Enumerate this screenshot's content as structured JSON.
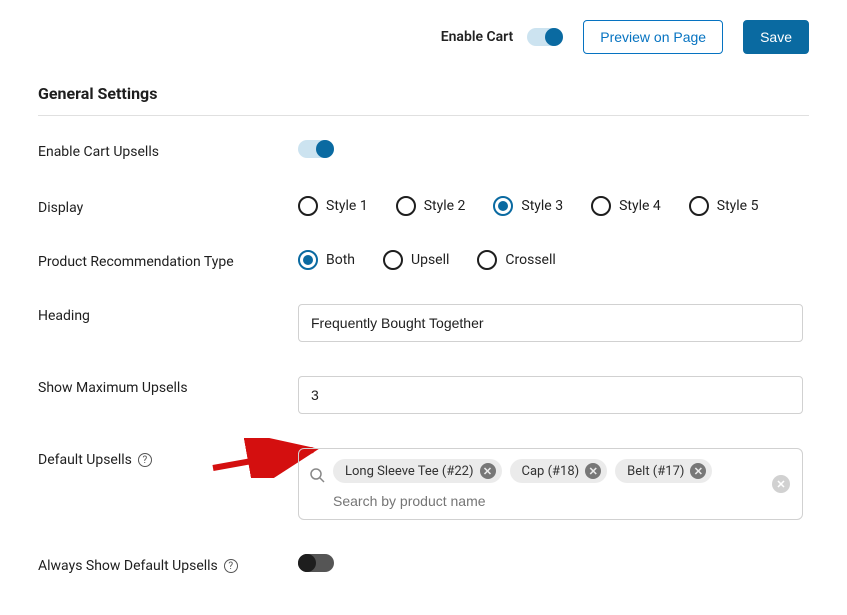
{
  "topbar": {
    "enableCartLabel": "Enable Cart",
    "previewButton": "Preview on Page",
    "saveButton": "Save"
  },
  "section": {
    "title": "General Settings"
  },
  "fields": {
    "enableUpsells": {
      "label": "Enable Cart Upsells"
    },
    "display": {
      "label": "Display",
      "options": [
        "Style 1",
        "Style 2",
        "Style 3",
        "Style 4",
        "Style 5"
      ],
      "selected": "Style 3"
    },
    "recommendationType": {
      "label": "Product Recommendation Type",
      "options": [
        "Both",
        "Upsell",
        "Crossell"
      ],
      "selected": "Both"
    },
    "heading": {
      "label": "Heading",
      "value": "Frequently Bought Together"
    },
    "maxUpsells": {
      "label": "Show Maximum Upsells",
      "value": "3"
    },
    "defaultUpsells": {
      "label": "Default Upsells",
      "tags": [
        "Long Sleeve Tee (#22)",
        "Cap (#18)",
        "Belt (#17)"
      ],
      "placeholder": "Search by product name"
    },
    "alwaysShow": {
      "label": "Always Show Default Upsells"
    }
  }
}
